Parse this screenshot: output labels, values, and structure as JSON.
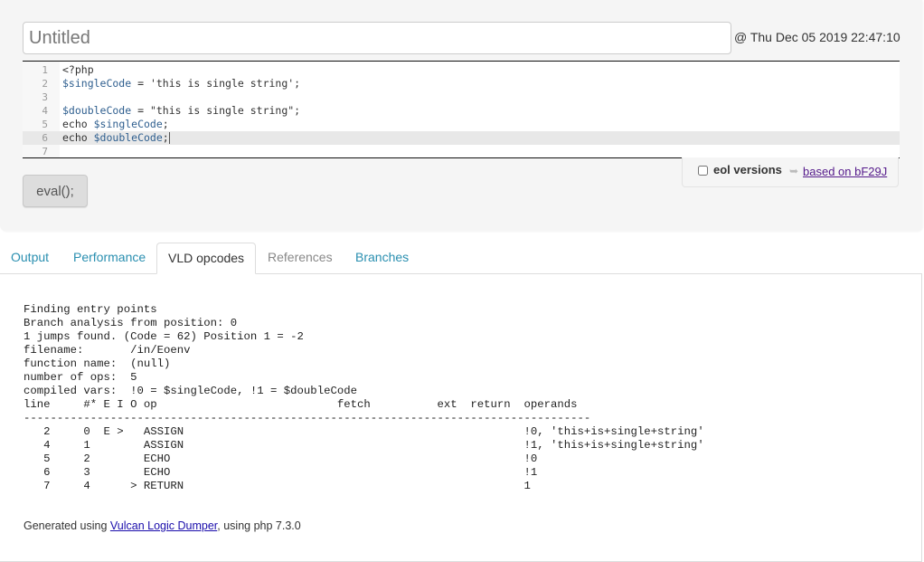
{
  "header": {
    "title_placeholder": "Untitled",
    "title_value": "",
    "timestamp": "@ Thu Dec 05 2019 22:47:10"
  },
  "editor": {
    "active_line": 6,
    "lines": [
      {
        "num": "1",
        "tokens": [
          {
            "t": "plain",
            "v": "<?php"
          }
        ]
      },
      {
        "num": "2",
        "tokens": [
          {
            "t": "var",
            "v": "$singleCode"
          },
          {
            "t": "plain",
            "v": " = 'this is single string';"
          }
        ]
      },
      {
        "num": "3",
        "tokens": []
      },
      {
        "num": "4",
        "tokens": [
          {
            "t": "var",
            "v": "$doubleCode"
          },
          {
            "t": "plain",
            "v": " = \"this is single string\";"
          }
        ]
      },
      {
        "num": "5",
        "tokens": [
          {
            "t": "plain",
            "v": "echo "
          },
          {
            "t": "var",
            "v": "$singleCode"
          },
          {
            "t": "plain",
            "v": ";"
          }
        ]
      },
      {
        "num": "6",
        "tokens": [
          {
            "t": "plain",
            "v": "echo "
          },
          {
            "t": "var",
            "v": "$doubleCode"
          },
          {
            "t": "plain",
            "v": ";"
          }
        ]
      },
      {
        "num": "7",
        "tokens": []
      }
    ]
  },
  "options": {
    "eol_label": "eol versions",
    "eol_checked": false,
    "based_on_label": "based on bF29J",
    "based_on_icon": "share-arrow-icon"
  },
  "actions": {
    "eval_label": "eval();"
  },
  "tabs": [
    {
      "label": "Output",
      "state": "link"
    },
    {
      "label": "Performance",
      "state": "link"
    },
    {
      "label": "VLD opcodes",
      "state": "active"
    },
    {
      "label": "References",
      "state": "disabled"
    },
    {
      "label": "Branches",
      "state": "link"
    }
  ],
  "vld": {
    "lines": [
      "Finding entry points",
      "Branch analysis from position: 0",
      "1 jumps found. (Code = 62) Position 1 = -2",
      "filename:       /in/Eoenv",
      "function name:  (null)",
      "number of ops:  5",
      "compiled vars:  !0 = $singleCode, !1 = $doubleCode",
      "line     #* E I O op                           fetch          ext  return  operands",
      "-------------------------------------------------------------------------------------",
      "   2     0  E >   ASSIGN                                                   !0, 'this+is+single+string'",
      "   4     1        ASSIGN                                                   !1, 'this+is+single+string'",
      "   5     2        ECHO                                                     !0",
      "   6     3        ECHO                                                     !1",
      "   7     4      > RETURN                                                   1"
    ],
    "summary": {
      "filename": "/in/Eoenv",
      "function_name": "(null)",
      "number_of_ops": "5",
      "compiled_vars": "!0 = $singleCode, !1 = $doubleCode",
      "columns": [
        "line",
        "#*",
        "E",
        "I",
        "O",
        "op",
        "fetch",
        "ext",
        "return",
        "operands"
      ],
      "rows": [
        {
          "line": "2",
          "num": "0",
          "E": "E",
          "I": "",
          "O": ">",
          "op": "ASSIGN",
          "operands": "!0, 'this+is+single+string'"
        },
        {
          "line": "4",
          "num": "1",
          "E": "",
          "I": "",
          "O": "",
          "op": "ASSIGN",
          "operands": "!1, 'this+is+single+string'"
        },
        {
          "line": "5",
          "num": "2",
          "E": "",
          "I": "",
          "O": "",
          "op": "ECHO",
          "operands": "!0"
        },
        {
          "line": "6",
          "num": "3",
          "E": "",
          "I": "",
          "O": "",
          "op": "ECHO",
          "operands": "!1"
        },
        {
          "line": "7",
          "num": "4",
          "E": "",
          "I": "",
          "O": ">",
          "op": "RETURN",
          "operands": "1"
        }
      ]
    }
  },
  "footer": {
    "prefix": "Generated using ",
    "link_label": "Vulcan Logic Dumper",
    "suffix": ", using php 7.3.0"
  }
}
